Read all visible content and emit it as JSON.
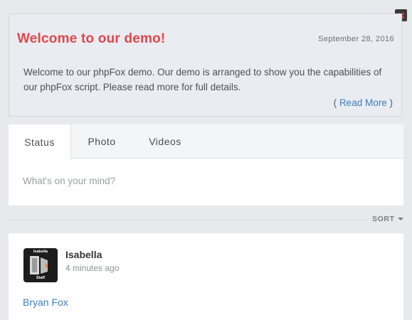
{
  "welcome": {
    "title": "Welcome to our demo!",
    "date": "September 28, 2016",
    "body": "Welcome to our phpFox demo. Our demo is arranged to show you the capabilities of our phpFox script. Please read more for full details.",
    "read_more_open": "(",
    "read_more_label": "Read More",
    "read_more_close": ")"
  },
  "composer": {
    "tabs": [
      {
        "label": "Status",
        "active": true
      },
      {
        "label": "Photo",
        "active": false
      },
      {
        "label": "Videos",
        "active": false
      }
    ],
    "placeholder": "What's on your mind?"
  },
  "sort": {
    "label": "SORT"
  },
  "feed": {
    "items": [
      {
        "author": "Isabella",
        "time": "4 minutes ago",
        "avatar_top_text": "Isabella",
        "avatar_bottom_text": "Staff",
        "link_text": "Bryan Fox"
      }
    ]
  },
  "colors": {
    "title_red": "#e1474a",
    "link_blue": "#3f7cc0",
    "background": "#e7e9ec"
  },
  "icons": {
    "close": "close-icon",
    "sort_caret": "caret-down-icon"
  }
}
